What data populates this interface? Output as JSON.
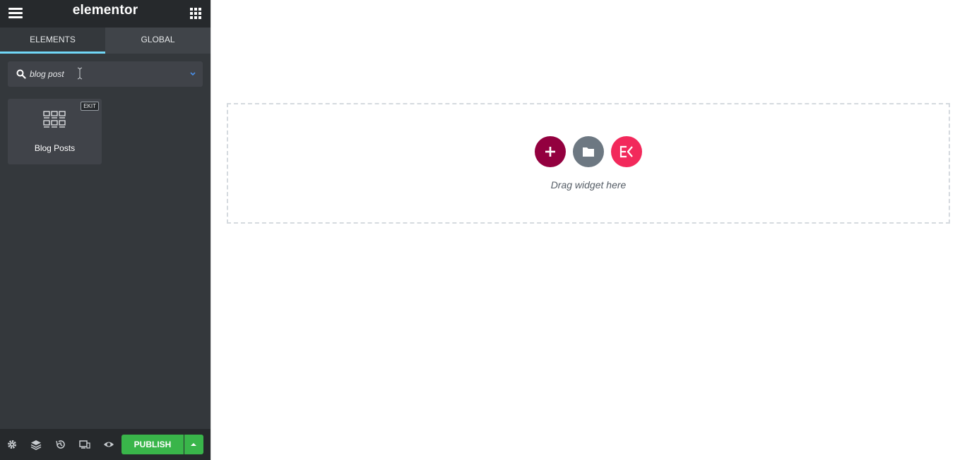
{
  "header": {
    "brand": "elementor",
    "menu_icon": "hamburger-icon",
    "apps_icon": "grid-apps-icon"
  },
  "tabs": [
    {
      "label": "ELEMENTS",
      "active": true
    },
    {
      "label": "GLOBAL",
      "active": false
    }
  ],
  "search": {
    "value": "blog post",
    "icon": "search-icon",
    "dropdown_icon": "chevron-down-icon"
  },
  "widgets": [
    {
      "label": "Blog Posts",
      "badge": "EKIT",
      "icon": "blog-posts-grid-icon"
    }
  ],
  "footer": {
    "icons": [
      "settings-icon",
      "layers-icon",
      "history-icon",
      "responsive-icon",
      "preview-eye-icon"
    ],
    "publish_label": "PUBLISH"
  },
  "canvas": {
    "drop_text": "Drag widget here",
    "buttons": [
      "add-section-plus-icon",
      "add-template-folder-icon",
      "elementskit-icon"
    ]
  },
  "colors": {
    "panel_bg": "#34383c",
    "header_bg": "#26292c",
    "active_tab_underline": "#71d7f7",
    "publish_green": "#39b54a",
    "add_section": "#93003f",
    "add_template": "#6d7882",
    "ekit_pink": "#f2295b"
  }
}
